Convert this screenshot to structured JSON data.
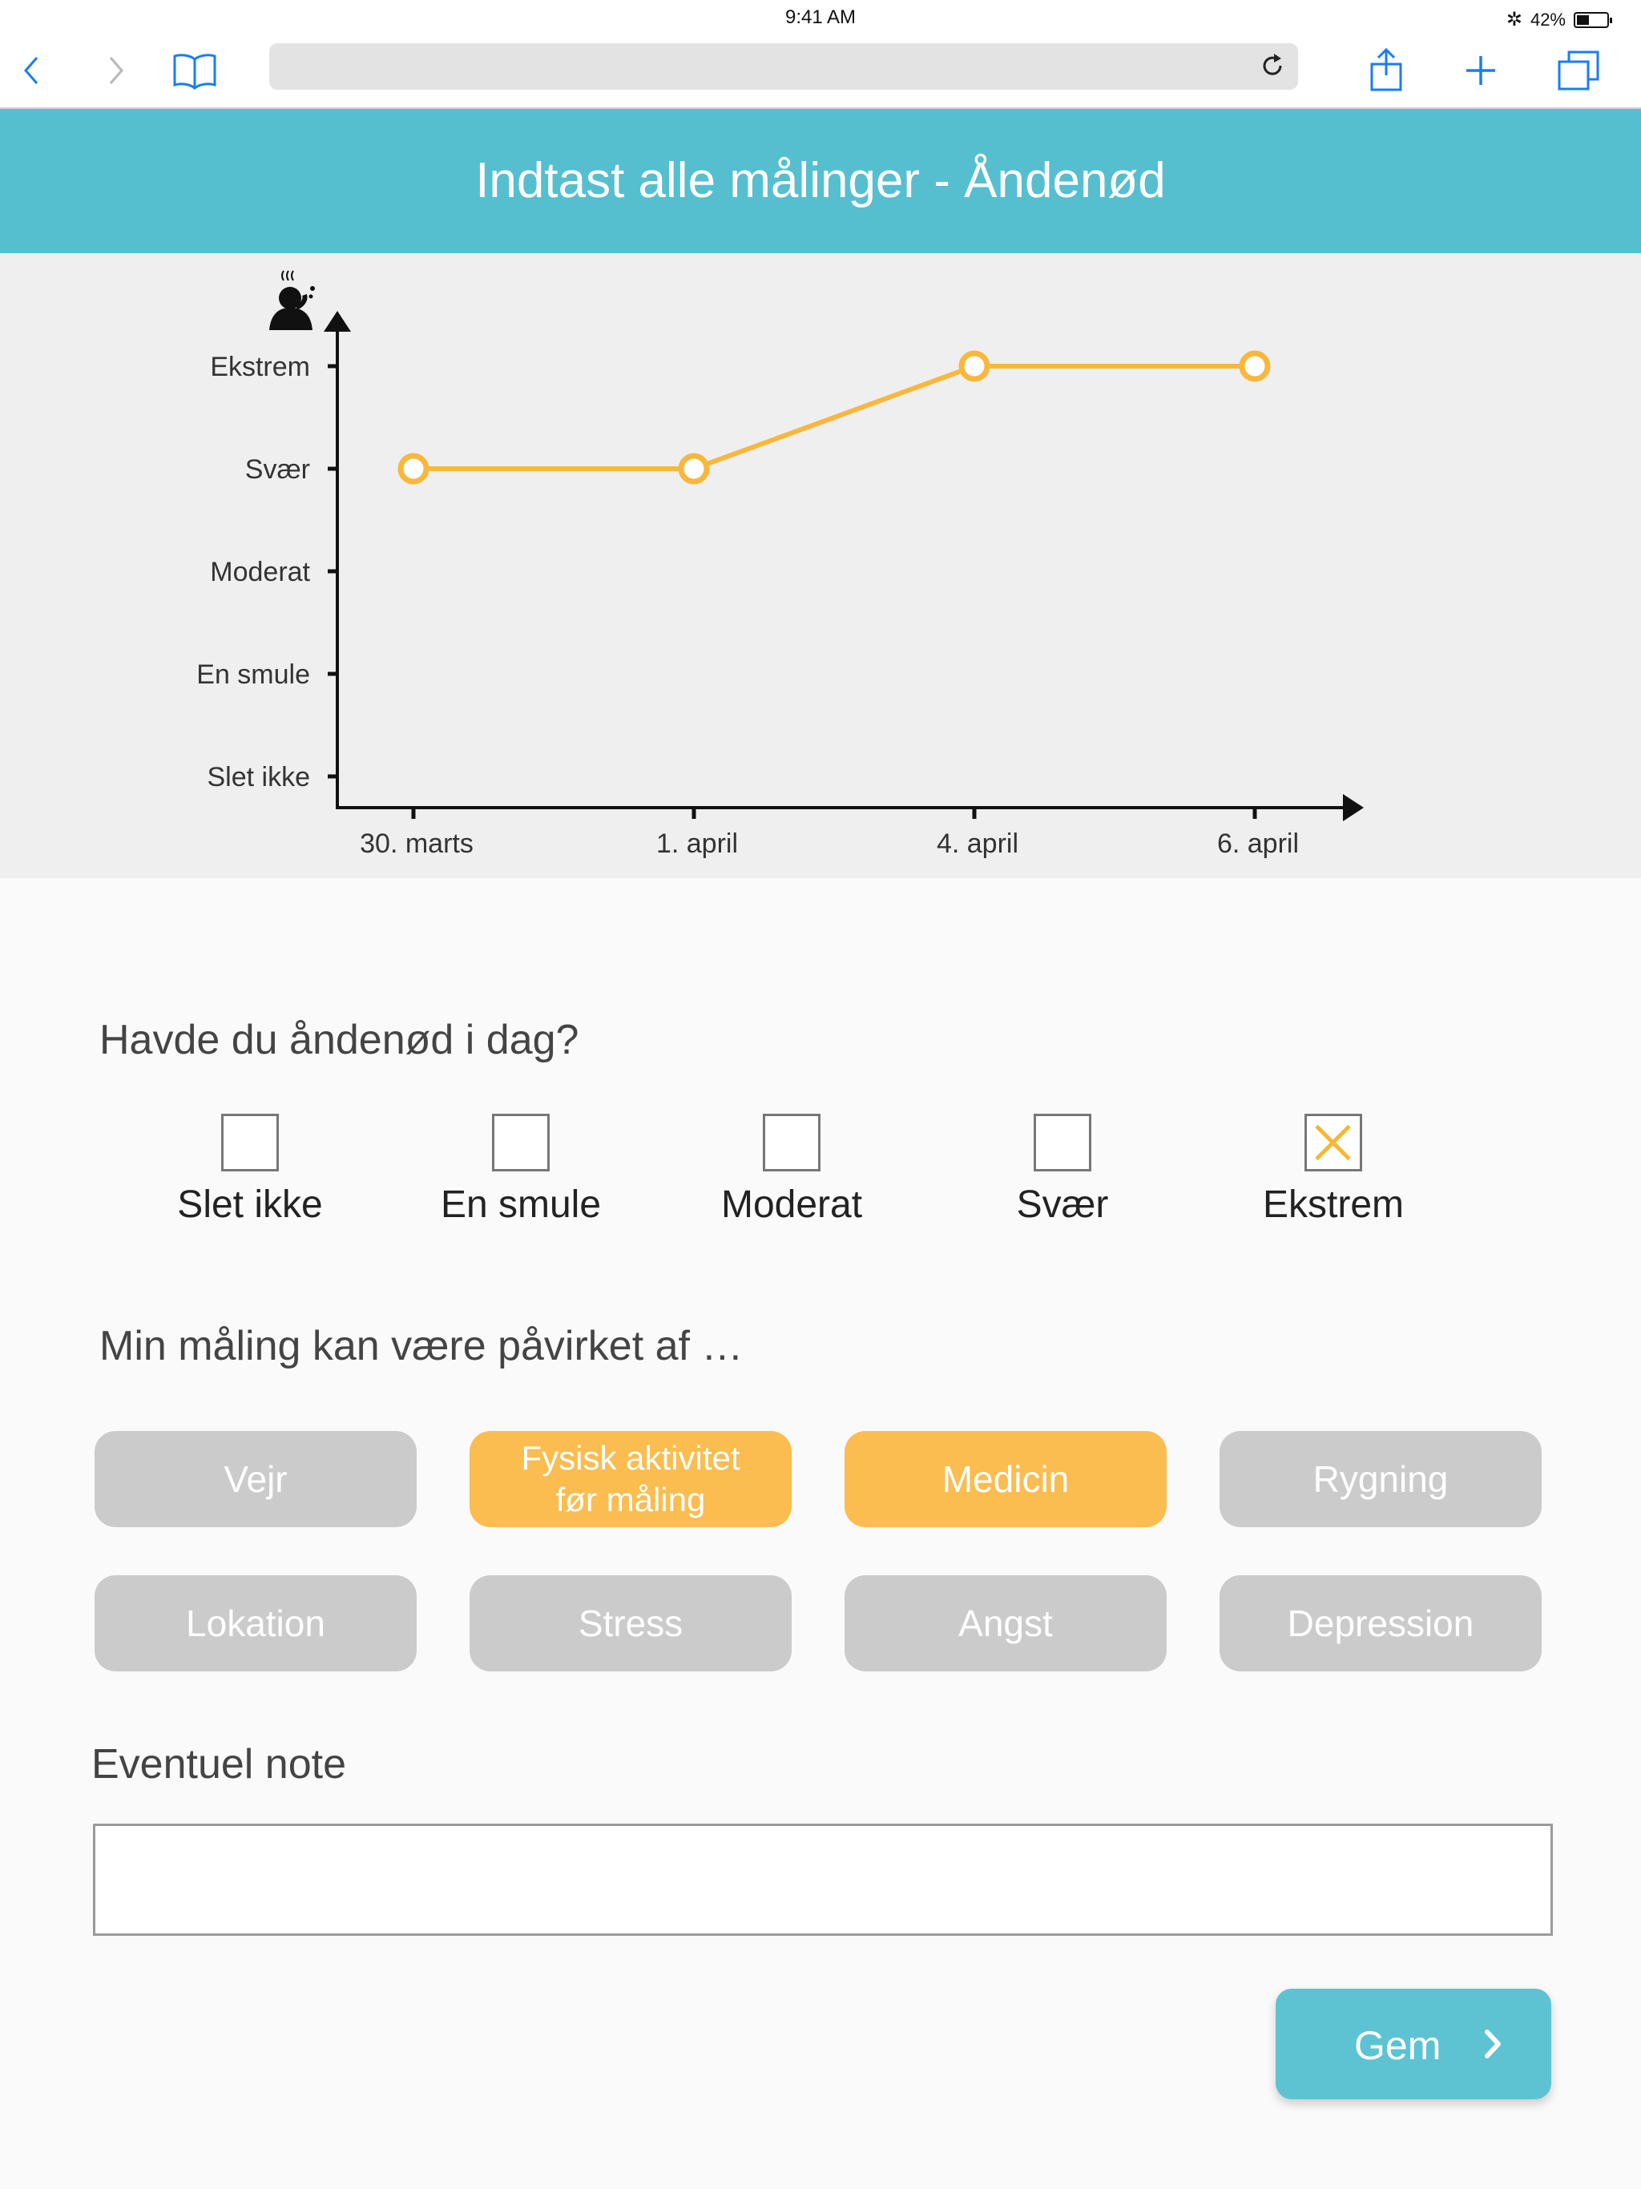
{
  "status_bar": {
    "time": "9:41 AM",
    "battery": "42%",
    "battery_level": 0.42
  },
  "browser": {
    "url": ""
  },
  "header": {
    "title": "Indtast alle målinger - Åndenød"
  },
  "chart_data": {
    "type": "line",
    "categories": [
      "30. marts",
      "1. april",
      "4. april",
      "6. april"
    ],
    "y_levels": [
      "Slet ikke",
      "En smule",
      "Moderat",
      "Svær",
      "Ekstrem"
    ],
    "values": [
      3,
      3,
      4,
      4
    ],
    "title": "",
    "xlabel": "",
    "ylabel": "",
    "ylim": [
      0,
      4
    ],
    "color": "#f9b73b",
    "grid": false
  },
  "question": {
    "title": "Havde du åndenød i dag?",
    "options": [
      {
        "label": "Slet ikke",
        "checked": false
      },
      {
        "label": "En smule",
        "checked": false
      },
      {
        "label": "Moderat",
        "checked": false
      },
      {
        "label": "Svær",
        "checked": false
      },
      {
        "label": "Ekstrem",
        "checked": true
      }
    ]
  },
  "factors": {
    "title": "Min måling kan være påvirket af …",
    "items": [
      {
        "label": "Vejr",
        "selected": false
      },
      {
        "label": "Fysisk aktivitet\nfør måling",
        "selected": true
      },
      {
        "label": "Medicin",
        "selected": true
      },
      {
        "label": "Rygning",
        "selected": false
      },
      {
        "label": "Lokation",
        "selected": false
      },
      {
        "label": "Stress",
        "selected": false
      },
      {
        "label": "Angst",
        "selected": false
      },
      {
        "label": "Depression",
        "selected": false
      }
    ]
  },
  "note": {
    "title": "Eventuel note",
    "value": "",
    "placeholder": ""
  },
  "save": {
    "label": "Gem"
  },
  "colors": {
    "header": "#55bfcf",
    "accent": "#f9b73b",
    "chip_off": "#cbcbcb",
    "save": "#5dc3d2",
    "browser_blue": "#1a7cf5"
  }
}
